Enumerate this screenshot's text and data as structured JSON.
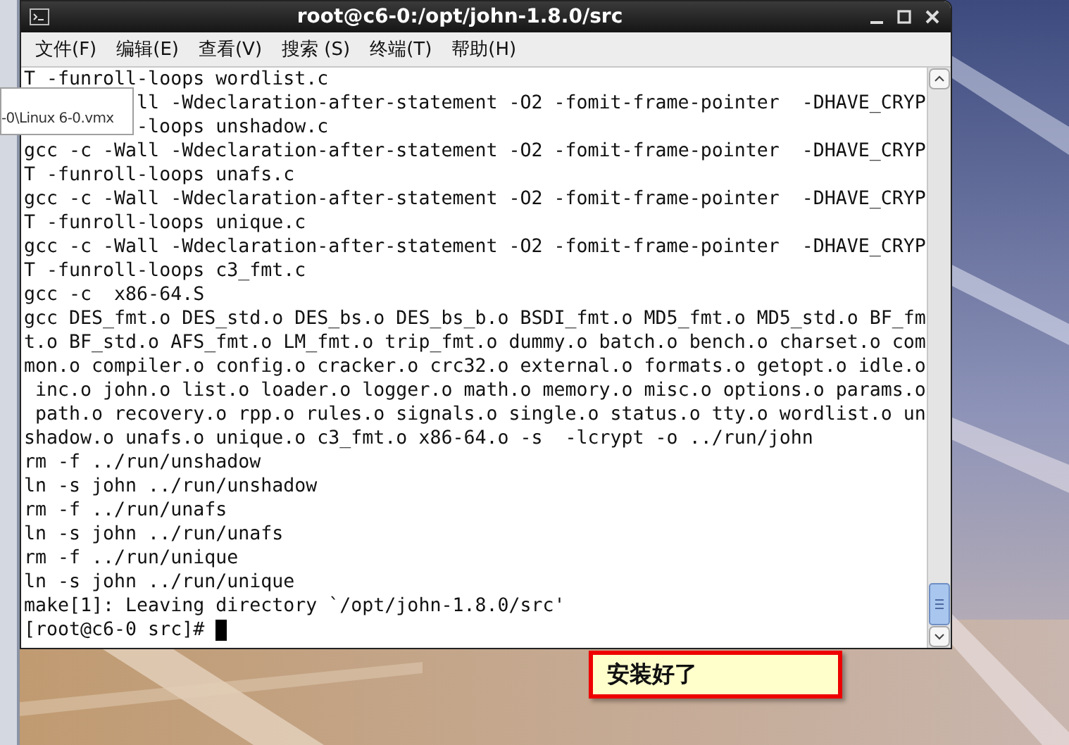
{
  "window": {
    "title": "root@c6-0:/opt/john-1.8.0/src"
  },
  "menu": [
    {
      "label": "文件(F)"
    },
    {
      "label": "编辑(E)"
    },
    {
      "label": "查看(V)"
    },
    {
      "label": "搜索 (S)"
    },
    {
      "label": "终端(T)"
    },
    {
      "label": "帮助(H)"
    }
  ],
  "terminal": {
    "lines": [
      {
        "text": "T -funroll-loops wordlist.c",
        "covered": false
      },
      {
        "text": "ll -Wdeclaration-after-statement -O2 -fomit-frame-pointer  -DHAVE_CRYP",
        "covered": true
      },
      {
        "text": "-loops unshadow.c",
        "covered": true
      },
      {
        "text": "gcc -c -Wall -Wdeclaration-after-statement -O2 -fomit-frame-pointer  -DHAVE_CRYP",
        "covered": false
      },
      {
        "text": "T -funroll-loops unafs.c",
        "covered": false
      },
      {
        "text": "gcc -c -Wall -Wdeclaration-after-statement -O2 -fomit-frame-pointer  -DHAVE_CRYP",
        "covered": false
      },
      {
        "text": "T -funroll-loops unique.c",
        "covered": false
      },
      {
        "text": "gcc -c -Wall -Wdeclaration-after-statement -O2 -fomit-frame-pointer  -DHAVE_CRYP",
        "covered": false
      },
      {
        "text": "T -funroll-loops c3_fmt.c",
        "covered": false
      },
      {
        "text": "gcc -c  x86-64.S",
        "covered": false
      },
      {
        "text": "gcc DES_fmt.o DES_std.o DES_bs.o DES_bs_b.o BSDI_fmt.o MD5_fmt.o MD5_std.o BF_fm",
        "covered": false
      },
      {
        "text": "t.o BF_std.o AFS_fmt.o LM_fmt.o trip_fmt.o dummy.o batch.o bench.o charset.o com",
        "covered": false
      },
      {
        "text": "mon.o compiler.o config.o cracker.o crc32.o external.o formats.o getopt.o idle.o",
        "covered": false
      },
      {
        "text": " inc.o john.o list.o loader.o logger.o math.o memory.o misc.o options.o params.o",
        "covered": false
      },
      {
        "text": " path.o recovery.o rpp.o rules.o signals.o single.o status.o tty.o wordlist.o un",
        "covered": false
      },
      {
        "text": "shadow.o unafs.o unique.o c3_fmt.o x86-64.o -s  -lcrypt -o ../run/john",
        "covered": false
      },
      {
        "text": "rm -f ../run/unshadow",
        "covered": false
      },
      {
        "text": "ln -s john ../run/unshadow",
        "covered": false
      },
      {
        "text": "rm -f ../run/unafs",
        "covered": false
      },
      {
        "text": "ln -s john ../run/unafs",
        "covered": false
      },
      {
        "text": "rm -f ../run/unique",
        "covered": false
      },
      {
        "text": "ln -s john ../run/unique",
        "covered": false
      },
      {
        "text": "make[1]: Leaving directory `/opt/john-1.8.0/src'",
        "covered": false
      }
    ],
    "prompt": "[root@c6-0 src]# "
  },
  "tooltip": {
    "text": "-0\\Linux 6-0.vmx"
  },
  "callout": {
    "text": "安装好了"
  }
}
